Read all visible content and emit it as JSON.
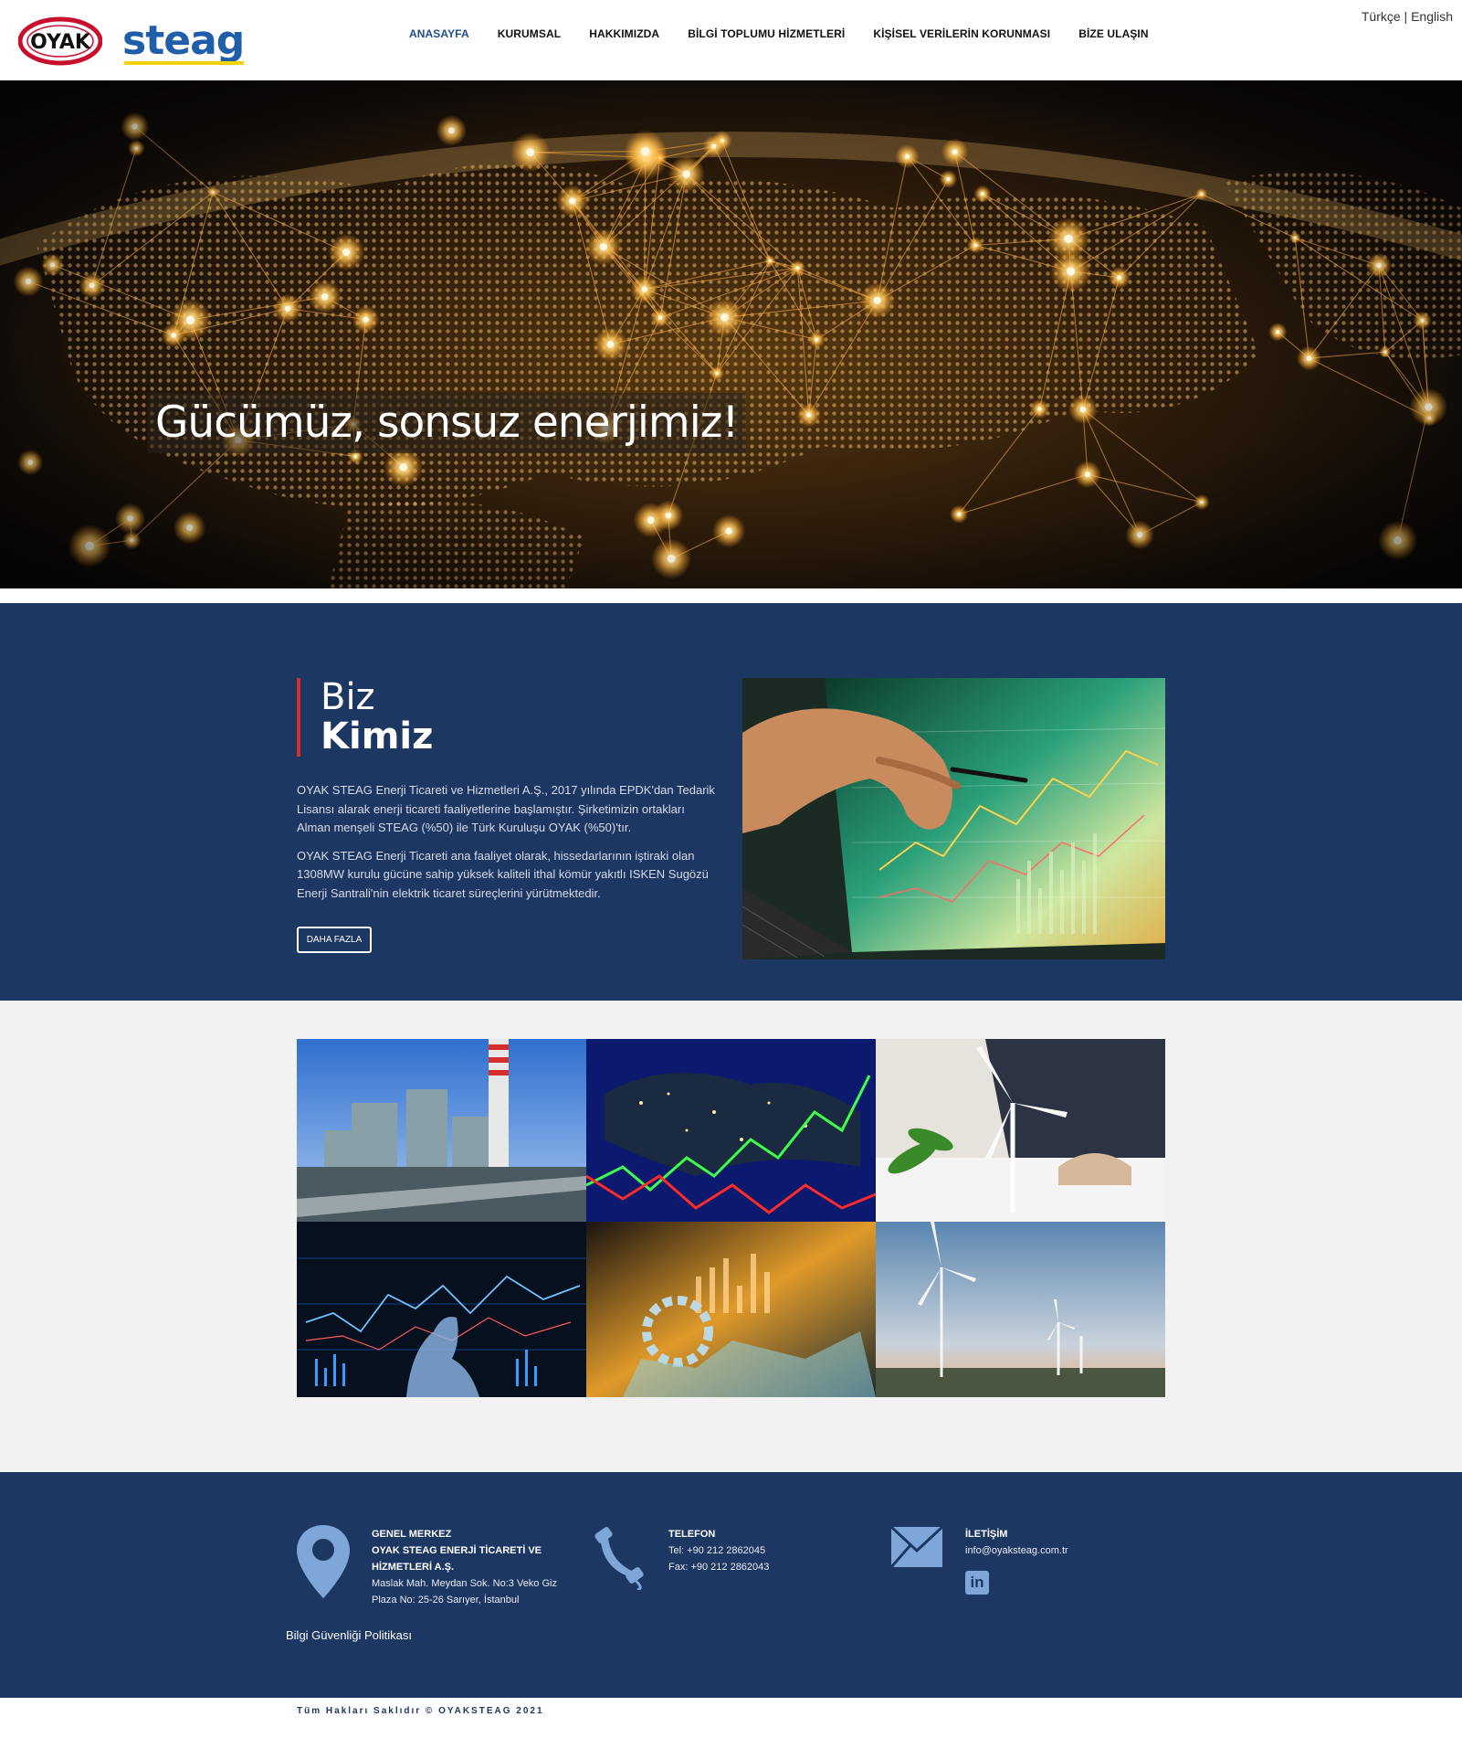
{
  "header": {
    "logo_oyak": "OYAK",
    "logo_steag": "steag",
    "language": {
      "tr": "Türkçe",
      "separator": " | ",
      "en": "English"
    },
    "nav": [
      {
        "label": "ANASAYFA",
        "active": true
      },
      {
        "label": "KURUMSAL"
      },
      {
        "label": "HAKKIMIZDA"
      },
      {
        "label": "BİLGİ TOPLUMU HİZMETLERİ"
      },
      {
        "label": "KİŞİSEL VERİLERİN KORUNMASI"
      },
      {
        "label": "BİZE ULAŞIN"
      }
    ]
  },
  "hero": {
    "caption": "Gücümüz, sonsuz enerjimiz!"
  },
  "about": {
    "title_line1": "Biz",
    "title_line2": "Kimiz",
    "paragraphs": [
      "OYAK STEAG Enerji Ticareti ve Hizmetleri A.Ş., 2017 yılında EPDK'dan Tedarik Lisansı alarak enerji ticareti faaliyetlerine başlamıştır. Şirketimizin ortakları Alman menşeli STEAG (%50) ile Türk Kuruluşu OYAK (%50)'tır.",
      "OYAK STEAG Enerji Ticareti ana faaliyet olarak, hissedarlarının iştiraki olan 1308MW kurulu gücüne sahip yüksek kaliteli ithal kömür yakıtlı ISKEN Sugözü Enerji Santrali'nin elektrik ticaret süreçlerini yürütmektedir."
    ],
    "more_button": "DAHA FAZLA"
  },
  "footer": {
    "hq_heading": "GENEL MERKEZ",
    "hq_company": "OYAK STEAG ENERJİ TİCARETİ VE HİZMETLERİ A.Ş.",
    "hq_address": "Maslak Mah. Meydan Sok. No:3 Veko Giz Plaza No: 25-26 Sarıyer, İstanbul",
    "phone_heading": "TELEFON",
    "phone": "Tel: +90 212 2862045",
    "fax": "Fax: +90 212 2862043",
    "contact_heading": "İLETİŞİM",
    "email": "info@oyaksteag.com.tr",
    "linkedin_label": "in",
    "policy_link": "Bilgi Güvenliği Politikası"
  },
  "copyright": "Tüm Hakları Saklıdır © OYAKSTEAG 2021",
  "colors": {
    "navy": "#1d3763",
    "accent_red": "#d32f2f",
    "steag_blue": "#1f5ea8",
    "steag_yellow": "#f5d20a"
  }
}
